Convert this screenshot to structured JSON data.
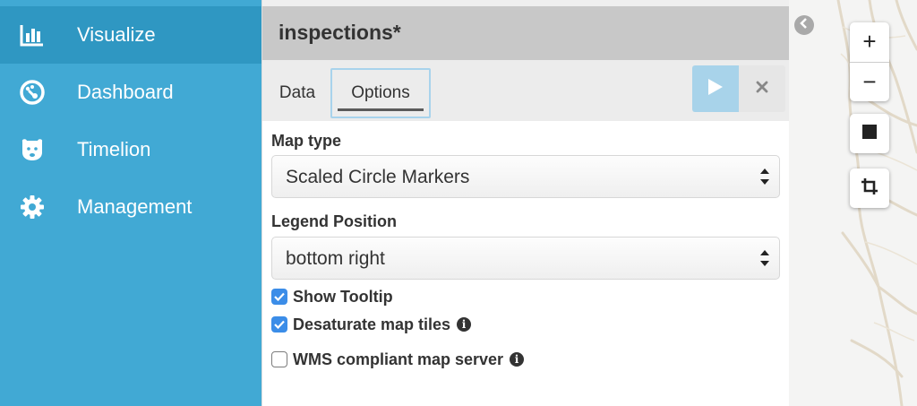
{
  "sidebar": {
    "items": [
      {
        "label": "Visualize",
        "icon": "bar-chart-icon",
        "active": true
      },
      {
        "label": "Dashboard",
        "icon": "dashboard-gauge-icon",
        "active": false
      },
      {
        "label": "Timelion",
        "icon": "bear-face-icon",
        "active": false
      },
      {
        "label": "Management",
        "icon": "gear-icon",
        "active": false
      }
    ]
  },
  "editor": {
    "title": "inspections*",
    "tabs": [
      {
        "label": "Data",
        "active": false
      },
      {
        "label": "Options",
        "active": true
      }
    ],
    "apply_icon": "play-icon",
    "discard_icon": "close-icon",
    "options": {
      "map_type": {
        "label": "Map type",
        "value": "Scaled Circle Markers"
      },
      "legend_position": {
        "label": "Legend Position",
        "value": "bottom right"
      },
      "checkboxes": [
        {
          "label": "Show Tooltip",
          "checked": true,
          "info": false
        },
        {
          "label": "Desaturate map tiles",
          "checked": true,
          "info": true
        },
        {
          "label": "WMS compliant map server",
          "checked": false,
          "info": true
        }
      ]
    }
  },
  "map": {
    "collapse_icon": "chevron-left-icon",
    "controls": {
      "zoom_in": "+",
      "zoom_out": "−",
      "draw_icon": "square-icon",
      "crop_icon": "crop-icon"
    }
  },
  "colors": {
    "sidebar_bg": "#41a9d4",
    "sidebar_active": "#2f97c2",
    "checkbox_checked": "#3b8de8",
    "apply_button": "#a8d3ea"
  }
}
